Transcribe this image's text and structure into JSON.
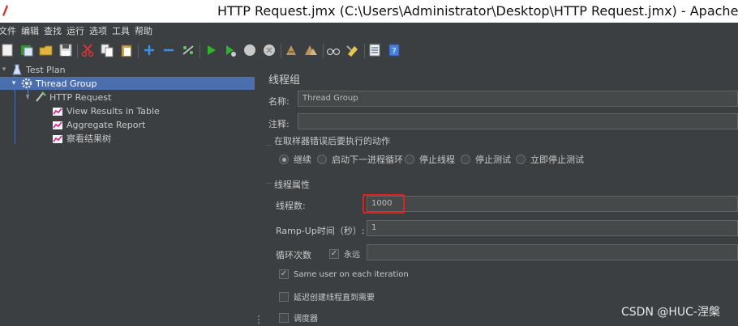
{
  "window": {
    "title": "HTTP Request.jmx (C:\\Users\\Administrator\\Desktop\\HTTP Request.jmx) - Apache J"
  },
  "menu": [
    "文件",
    "编辑",
    "查找",
    "运行",
    "选项",
    "工具",
    "帮助"
  ],
  "toolbar_icons": [
    "new-icon",
    "templates-icon",
    "open-icon",
    "save-icon",
    "cut-icon",
    "copy-icon",
    "paste-icon",
    "expand-icon",
    "collapse-icon",
    "toggle-icon",
    "start-icon",
    "start-no-pause-icon",
    "stop-icon",
    "shutdown-icon",
    "clear-icon",
    "clear-all-icon",
    "search-icon",
    "reset-search-icon",
    "function-helper-icon",
    "help-icon"
  ],
  "tree": {
    "items": [
      {
        "label": "Test Plan",
        "icon": "test-plan-icon"
      },
      {
        "label": "Thread Group",
        "icon": "gear-icon",
        "selected": true
      },
      {
        "label": "HTTP Request",
        "icon": "sampler-icon"
      },
      {
        "label": "View Results in Table",
        "icon": "listener-icon"
      },
      {
        "label": "Aggregate Report",
        "icon": "listener-icon"
      },
      {
        "label": "察看结果树",
        "icon": "listener-icon"
      }
    ]
  },
  "panel": {
    "title": "线程组",
    "name_label": "名称:",
    "name_value": "Thread Group",
    "comment_label": "注释:",
    "comment_value": "",
    "error_action": {
      "title": "在取样器错误后要执行的动作",
      "options": [
        "继续",
        "启动下一进程循环",
        "停止线程",
        "停止测试",
        "立即停止测试"
      ],
      "selected": "继续"
    },
    "thread_props": {
      "title": "线程属性",
      "threads_label": "线程数:",
      "threads_value": "1000",
      "rampup_label": "Ramp-Up时间（秒）:",
      "rampup_value": "1",
      "loop_label": "循环次数",
      "forever_label": "永远",
      "forever_checked": true,
      "loop_value": "",
      "same_user_label": "Same user on each iteration",
      "same_user_checked": true,
      "delay_label": "延迟创建线程直到需要",
      "delay_checked": false,
      "scheduler_label": "调度器",
      "scheduler_checked": false
    }
  },
  "watermark": "CSDN @HUC-涅槃",
  "colors": {
    "background": "#3c3f41",
    "selection": "#4b6eaf",
    "highlight": "#e02020"
  }
}
